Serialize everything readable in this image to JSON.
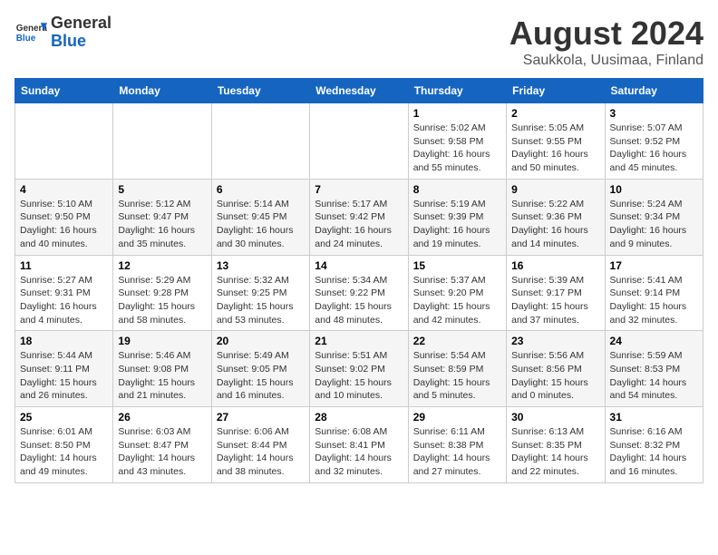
{
  "header": {
    "logo_general": "General",
    "logo_blue": "Blue",
    "title": "August 2024",
    "subtitle": "Saukkola, Uusimaa, Finland"
  },
  "weekdays": [
    "Sunday",
    "Monday",
    "Tuesday",
    "Wednesday",
    "Thursday",
    "Friday",
    "Saturday"
  ],
  "weeks": [
    [
      {
        "day": "",
        "info": ""
      },
      {
        "day": "",
        "info": ""
      },
      {
        "day": "",
        "info": ""
      },
      {
        "day": "",
        "info": ""
      },
      {
        "day": "1",
        "info": "Sunrise: 5:02 AM\nSunset: 9:58 PM\nDaylight: 16 hours\nand 55 minutes."
      },
      {
        "day": "2",
        "info": "Sunrise: 5:05 AM\nSunset: 9:55 PM\nDaylight: 16 hours\nand 50 minutes."
      },
      {
        "day": "3",
        "info": "Sunrise: 5:07 AM\nSunset: 9:52 PM\nDaylight: 16 hours\nand 45 minutes."
      }
    ],
    [
      {
        "day": "4",
        "info": "Sunrise: 5:10 AM\nSunset: 9:50 PM\nDaylight: 16 hours\nand 40 minutes."
      },
      {
        "day": "5",
        "info": "Sunrise: 5:12 AM\nSunset: 9:47 PM\nDaylight: 16 hours\nand 35 minutes."
      },
      {
        "day": "6",
        "info": "Sunrise: 5:14 AM\nSunset: 9:45 PM\nDaylight: 16 hours\nand 30 minutes."
      },
      {
        "day": "7",
        "info": "Sunrise: 5:17 AM\nSunset: 9:42 PM\nDaylight: 16 hours\nand 24 minutes."
      },
      {
        "day": "8",
        "info": "Sunrise: 5:19 AM\nSunset: 9:39 PM\nDaylight: 16 hours\nand 19 minutes."
      },
      {
        "day": "9",
        "info": "Sunrise: 5:22 AM\nSunset: 9:36 PM\nDaylight: 16 hours\nand 14 minutes."
      },
      {
        "day": "10",
        "info": "Sunrise: 5:24 AM\nSunset: 9:34 PM\nDaylight: 16 hours\nand 9 minutes."
      }
    ],
    [
      {
        "day": "11",
        "info": "Sunrise: 5:27 AM\nSunset: 9:31 PM\nDaylight: 16 hours\nand 4 minutes."
      },
      {
        "day": "12",
        "info": "Sunrise: 5:29 AM\nSunset: 9:28 PM\nDaylight: 15 hours\nand 58 minutes."
      },
      {
        "day": "13",
        "info": "Sunrise: 5:32 AM\nSunset: 9:25 PM\nDaylight: 15 hours\nand 53 minutes."
      },
      {
        "day": "14",
        "info": "Sunrise: 5:34 AM\nSunset: 9:22 PM\nDaylight: 15 hours\nand 48 minutes."
      },
      {
        "day": "15",
        "info": "Sunrise: 5:37 AM\nSunset: 9:20 PM\nDaylight: 15 hours\nand 42 minutes."
      },
      {
        "day": "16",
        "info": "Sunrise: 5:39 AM\nSunset: 9:17 PM\nDaylight: 15 hours\nand 37 minutes."
      },
      {
        "day": "17",
        "info": "Sunrise: 5:41 AM\nSunset: 9:14 PM\nDaylight: 15 hours\nand 32 minutes."
      }
    ],
    [
      {
        "day": "18",
        "info": "Sunrise: 5:44 AM\nSunset: 9:11 PM\nDaylight: 15 hours\nand 26 minutes."
      },
      {
        "day": "19",
        "info": "Sunrise: 5:46 AM\nSunset: 9:08 PM\nDaylight: 15 hours\nand 21 minutes."
      },
      {
        "day": "20",
        "info": "Sunrise: 5:49 AM\nSunset: 9:05 PM\nDaylight: 15 hours\nand 16 minutes."
      },
      {
        "day": "21",
        "info": "Sunrise: 5:51 AM\nSunset: 9:02 PM\nDaylight: 15 hours\nand 10 minutes."
      },
      {
        "day": "22",
        "info": "Sunrise: 5:54 AM\nSunset: 8:59 PM\nDaylight: 15 hours\nand 5 minutes."
      },
      {
        "day": "23",
        "info": "Sunrise: 5:56 AM\nSunset: 8:56 PM\nDaylight: 15 hours\nand 0 minutes."
      },
      {
        "day": "24",
        "info": "Sunrise: 5:59 AM\nSunset: 8:53 PM\nDaylight: 14 hours\nand 54 minutes."
      }
    ],
    [
      {
        "day": "25",
        "info": "Sunrise: 6:01 AM\nSunset: 8:50 PM\nDaylight: 14 hours\nand 49 minutes."
      },
      {
        "day": "26",
        "info": "Sunrise: 6:03 AM\nSunset: 8:47 PM\nDaylight: 14 hours\nand 43 minutes."
      },
      {
        "day": "27",
        "info": "Sunrise: 6:06 AM\nSunset: 8:44 PM\nDaylight: 14 hours\nand 38 minutes."
      },
      {
        "day": "28",
        "info": "Sunrise: 6:08 AM\nSunset: 8:41 PM\nDaylight: 14 hours\nand 32 minutes."
      },
      {
        "day": "29",
        "info": "Sunrise: 6:11 AM\nSunset: 8:38 PM\nDaylight: 14 hours\nand 27 minutes."
      },
      {
        "day": "30",
        "info": "Sunrise: 6:13 AM\nSunset: 8:35 PM\nDaylight: 14 hours\nand 22 minutes."
      },
      {
        "day": "31",
        "info": "Sunrise: 6:16 AM\nSunset: 8:32 PM\nDaylight: 14 hours\nand 16 minutes."
      }
    ]
  ]
}
